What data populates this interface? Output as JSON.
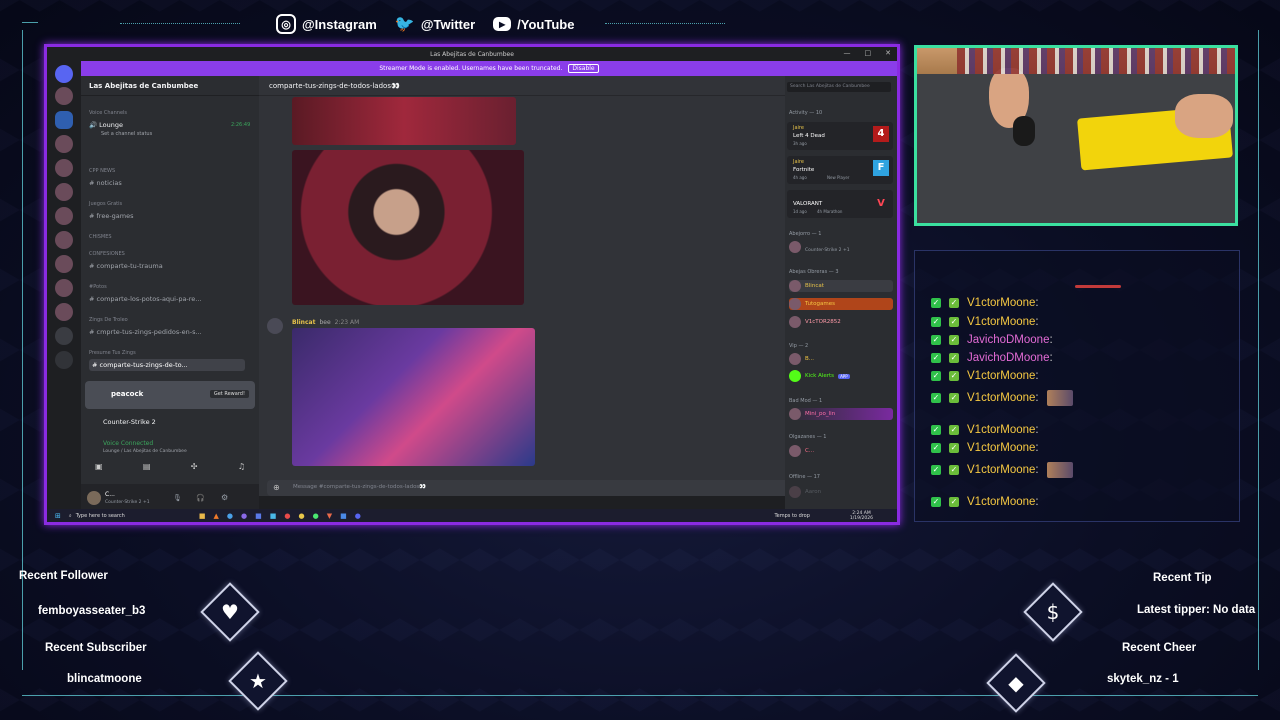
{
  "socials": [
    {
      "icon": "instagram-icon",
      "label": "@Instagram"
    },
    {
      "icon": "twitter-icon",
      "label": "@Twitter"
    },
    {
      "icon": "youtube-icon",
      "label": "/YouTube"
    }
  ],
  "discord": {
    "window_title": "Las Abejitas de Canbumbee",
    "banner_text": "Streamer Mode is enabled. Usernames have been truncated.",
    "banner_button": "Disable",
    "server_name": "Las Abejitas de Canbumbee",
    "channels": [
      {
        "type": "category",
        "label": "Voice Channels"
      },
      {
        "type": "voice",
        "label": "Lounge",
        "timer": "2:26:49",
        "status": "Set a channel status"
      },
      {
        "type": "category",
        "label": "CPP NEWS"
      },
      {
        "type": "text",
        "label": "noticias"
      },
      {
        "type": "category",
        "label": "Juegos Gratis"
      },
      {
        "type": "text",
        "label": "free-games"
      },
      {
        "type": "category",
        "label": "CHISMES"
      },
      {
        "type": "category",
        "label": "CONFESIONES"
      },
      {
        "type": "text",
        "label": "comparte-tu-trauma"
      },
      {
        "type": "category",
        "label": "#Potos"
      },
      {
        "type": "text",
        "label": "comparte-los-potos-aqui-pa-re..."
      },
      {
        "type": "category",
        "label": "Zings De Troleo"
      },
      {
        "type": "text",
        "label": "cmprte-tus-zings-pedidos-en-s..."
      },
      {
        "type": "category",
        "label": "Presume Tus Zings"
      },
      {
        "type": "text",
        "label": "comparte-tus-zings-de-to...",
        "active": true
      }
    ],
    "peacock": {
      "label": "peacock",
      "button": "Get Reward!"
    },
    "activity_game": "Counter-Strike 2",
    "voice_connected": {
      "title": "Voice Connected",
      "detail": "Lounge / Las Abejitas de Canbumbee"
    },
    "user": {
      "name": "C...",
      "status": "Counter-Strike 2 +1"
    },
    "channel_title": "comparte-tus-zings-de-todos-lados👀",
    "message": {
      "author": "Blincat",
      "tag": "bee",
      "time": "2:23 AM"
    },
    "composer_placeholder": "Message #comparte-tus-zings-de-todos-lados👀",
    "search_placeholder": "Search Las Abejitas de Canbumbee",
    "activity_header": "Activity — 10",
    "activities": [
      {
        "user": "Jaire",
        "game": "Left 4 Dead",
        "time": "3h ago",
        "badge": "4"
      },
      {
        "user": "Jaire",
        "game": "Fortnite",
        "time": "4h ago",
        "extra": "New Player",
        "badge": "F"
      },
      {
        "user": "",
        "game": "VALORANT",
        "time": "1d ago",
        "extra": "4h Marathon",
        "badge": "V"
      }
    ],
    "member_groups": [
      {
        "title": "Abejorro — 1",
        "members": [
          {
            "name": "",
            "sub": "Counter-Strike 2 +1"
          }
        ]
      },
      {
        "title": "Abejas Obreras — 3",
        "members": [
          {
            "name": "Blincat",
            "sub": "In voice"
          },
          {
            "name": "Tutogames",
            "sub": ""
          },
          {
            "name": "V1cTOR2852",
            "sub": ""
          }
        ]
      },
      {
        "title": "Vip — 2",
        "members": [
          {
            "name": "B...",
            "sub": ""
          },
          {
            "name": "Kick Alerts",
            "sub": "APP"
          }
        ]
      },
      {
        "title": "Bad Mod — 1",
        "members": [
          {
            "name": "Mini_po_lin",
            "sub": ""
          }
        ]
      },
      {
        "title": "Olgazanes — 1",
        "members": [
          {
            "name": "C...",
            "sub": ""
          }
        ]
      },
      {
        "title": "Offline — 17",
        "members": [
          {
            "name": "Aaron",
            "sub": ""
          }
        ]
      }
    ],
    "taskbar": {
      "search": "Type here to search",
      "weather": "Temps to drop",
      "time": "2:24 AM",
      "date": "1/19/2026"
    }
  },
  "stream_chat": [
    {
      "user": "V1ctorMoone",
      "msg": ":",
      "color": "#f5c842"
    },
    {
      "user": "V1ctorMoone",
      "msg": ":",
      "color": "#f5c842"
    },
    {
      "user": "JavichoDMoone",
      "msg": ":",
      "color": "#e36bd5"
    },
    {
      "user": "JavichoDMoone",
      "msg": ":",
      "color": "#e36bd5"
    },
    {
      "user": "V1ctorMoone",
      "msg": ":",
      "color": "#f5c842"
    },
    {
      "user": "V1ctorMoone",
      "msg": ":",
      "color": "#f5c842",
      "emote": true
    },
    {
      "user": "V1ctorMoone",
      "msg": ":",
      "color": "#f5c842"
    },
    {
      "user": "V1ctorMoone",
      "msg": ":",
      "color": "#f5c842"
    },
    {
      "user": "V1ctorMoone",
      "msg": ":",
      "color": "#f5c842",
      "emote": true
    },
    {
      "user": "V1ctorMoone",
      "msg": ":",
      "color": "#f5c842"
    }
  ],
  "widgets": {
    "recent_follower_label": "Recent Follower",
    "recent_follower": "femboyasseater_b3",
    "recent_subscriber_label": "Recent Subscriber",
    "recent_subscriber": "blincatmoone",
    "recent_tip_label": "Recent Tip",
    "recent_tip": "Latest tipper: No data",
    "recent_cheer_label": "Recent Cheer",
    "recent_cheer": "skytek_nz - 1"
  },
  "colors": {
    "accent": "#8a2be2",
    "cam_border": "#3be0a0",
    "frame": "#5cc6d0"
  }
}
